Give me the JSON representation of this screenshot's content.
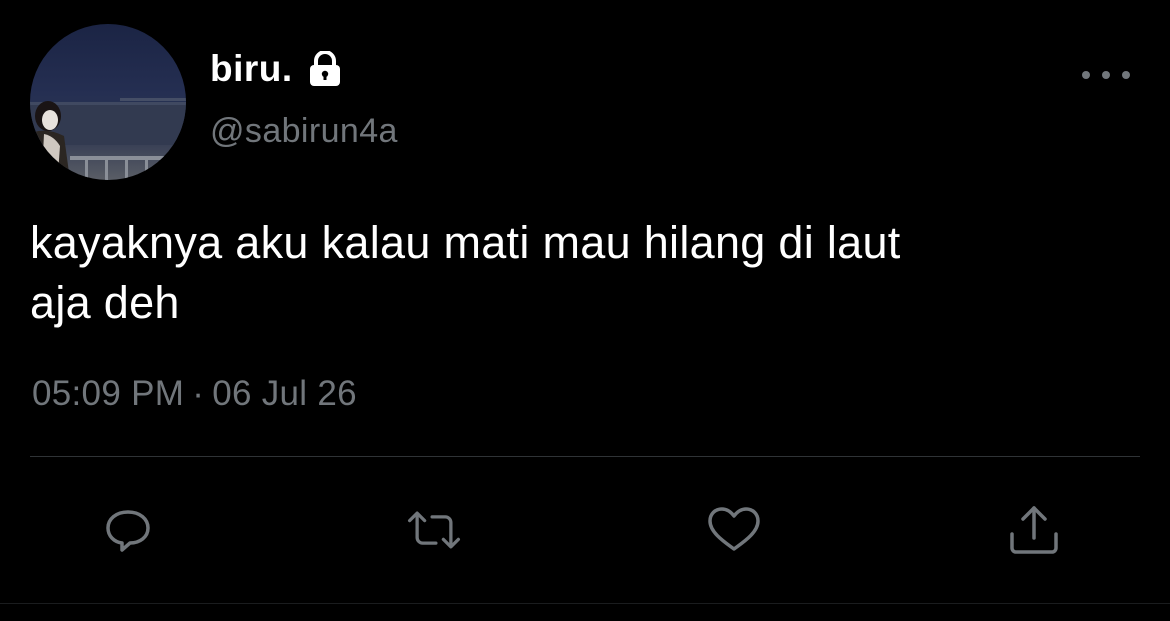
{
  "tweet": {
    "author": {
      "display_name": "biru.",
      "handle": "@sabirun4a",
      "protected": true,
      "lock_icon": "lock-icon",
      "avatar": "profile-photo"
    },
    "more_icon": "more-horizontal-icon",
    "text_lines": [
      "kayaknya aku kalau mati mau hilang di laut",
      "aja deh"
    ],
    "time": "05:09 PM",
    "separator": "·",
    "date": "06 Jul 26"
  },
  "actions": [
    {
      "name": "reply",
      "icon": "reply-icon"
    },
    {
      "name": "retweet",
      "icon": "retweet-icon"
    },
    {
      "name": "like",
      "icon": "heart-icon"
    },
    {
      "name": "share",
      "icon": "share-icon"
    }
  ],
  "colors": {
    "background": "#000000",
    "text_primary": "#ffffff",
    "text_secondary": "#71767b",
    "divider": "#2f3336"
  }
}
